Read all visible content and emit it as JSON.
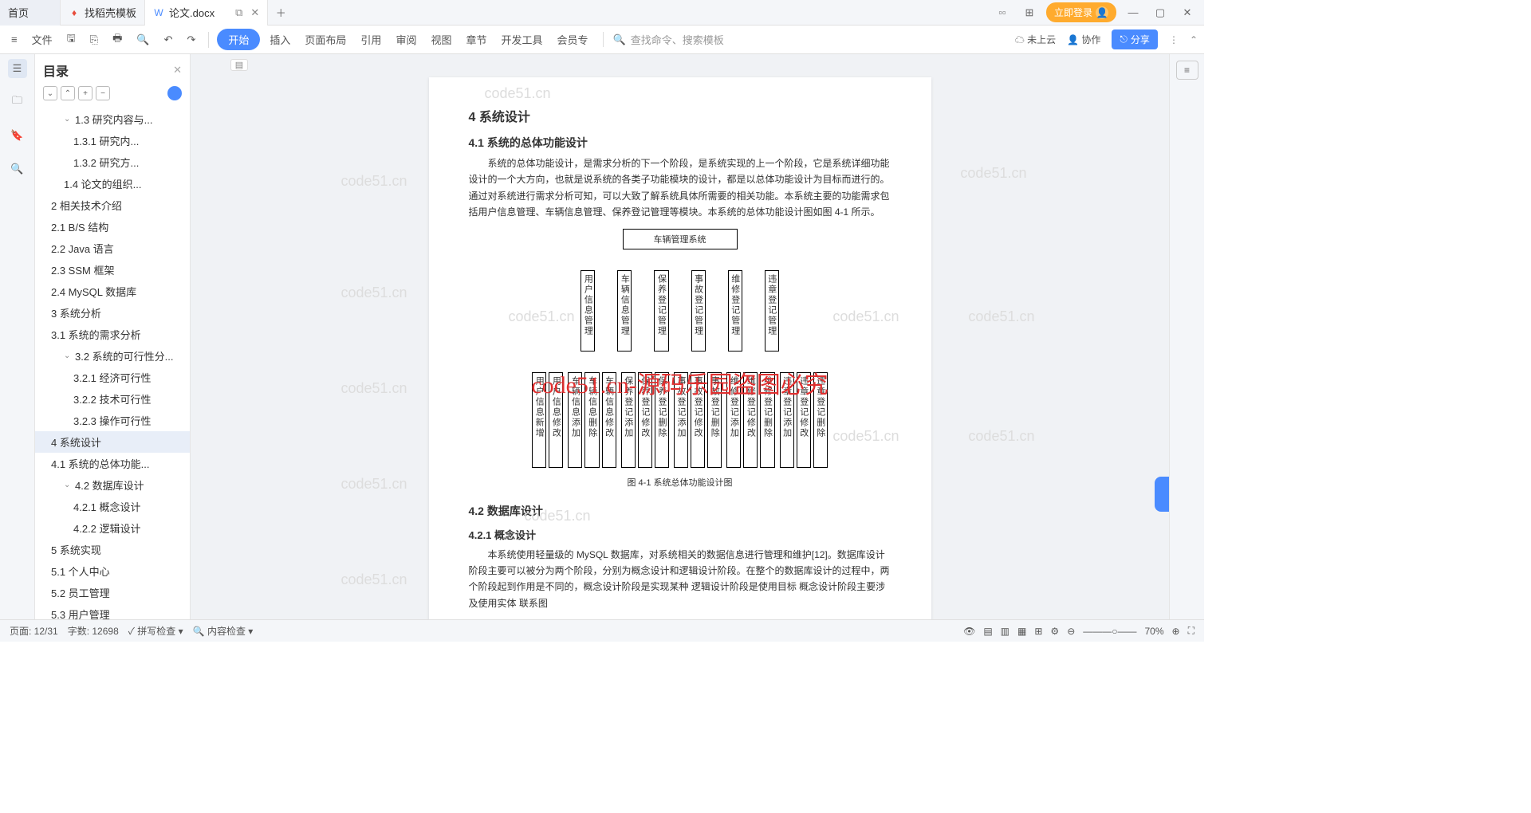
{
  "tabs": {
    "home": "首页",
    "t1": "找稻壳模板",
    "t2": "论文.docx"
  },
  "login": "立即登录",
  "ribbon": {
    "file": "文件",
    "start": "开始",
    "insert": "插入",
    "layout": "页面布局",
    "ref": "引用",
    "review": "审阅",
    "view": "视图",
    "chapter": "章节",
    "dev": "开发工具",
    "member": "会员专",
    "searchPlaceholder": "查找命令、搜索模板",
    "cloud": "未上云",
    "collab": "协作",
    "share": "分享"
  },
  "outline": {
    "title": "目录",
    "items": [
      {
        "t": "1.3 研究内容与...",
        "l": 2,
        "c": 1
      },
      {
        "t": "1.3.1 研究内...",
        "l": 3
      },
      {
        "t": "1.3.2 研究方...",
        "l": 3
      },
      {
        "t": "1.4 论文的组织...",
        "l": 2
      },
      {
        "t": "2 相关技术介绍",
        "l": 1
      },
      {
        "t": "2.1 B/S 结构",
        "l": 1
      },
      {
        "t": "2.2 Java 语言",
        "l": 1
      },
      {
        "t": "2.3 SSM 框架",
        "l": 1
      },
      {
        "t": "2.4 MySQL 数据库",
        "l": 1
      },
      {
        "t": "3 系统分析",
        "l": 1
      },
      {
        "t": "3.1 系统的需求分析",
        "l": 1
      },
      {
        "t": "3.2 系统的可行性分...",
        "l": 2,
        "c": 1
      },
      {
        "t": "3.2.1 经济可行性",
        "l": 3
      },
      {
        "t": "3.2.2 技术可行性",
        "l": 3
      },
      {
        "t": "3.2.3 操作可行性",
        "l": 3
      },
      {
        "t": "4 系统设计",
        "l": 1,
        "sel": 1
      },
      {
        "t": "4.1 系统的总体功能...",
        "l": 1
      },
      {
        "t": "4.2 数据库设计",
        "l": 2,
        "c": 1
      },
      {
        "t": "4.2.1 概念设计",
        "l": 3
      },
      {
        "t": "4.2.2 逻辑设计",
        "l": 3
      },
      {
        "t": "5 系统实现",
        "l": 1
      },
      {
        "t": "5.1 个人中心",
        "l": 1
      },
      {
        "t": "5.2 员工管理",
        "l": 1
      },
      {
        "t": "5.3 用户管理",
        "l": 1
      }
    ]
  },
  "doc": {
    "h4": "4 系统设计",
    "h41": "4.1 系统的总体功能设计",
    "p41": "系统的总体功能设计，是需求分析的下一个阶段，是系统实现的上一个阶段，它是系统详细功能设计的一个大方向，也就是说系统的各类子功能模块的设计，都是以总体功能设计为目标而进行的。通过对系统进行需求分析可知，可以大致了解系统具体所需要的相关功能。本系统主要的功能需求包括用户信息管理、车辆信息管理、保养登记管理等模块。本系统的总体功能设计图如图 4-1 所示。",
    "caption": "图 4-1 系统总体功能设计图",
    "h42": "4.2 数据库设计",
    "h421": "4.2.1 概念设计",
    "p421": "本系统使用轻量级的 MySQL 数据库，对系统相关的数据信息进行管理和维护[12]。数据库设计阶段主要可以被分为两个阶段，分别为概念设计和逻辑设计阶段。在整个的数据库设计的过程中，两个阶段起到作用是不同的，概念设计阶段是实现某种  逻辑设计阶段是使用目标  概念设计阶段主要涉及使用实体 联系图"
  },
  "chart_data": {
    "type": "diagram",
    "root": "车辆管理系统",
    "level1": [
      "用户信息管理",
      "车辆信息管理",
      "保养登记管理",
      "事故登记管理",
      "维修登记管理",
      "违章登记管理"
    ],
    "level2": [
      [
        "用户信息新增",
        "用户信息修改"
      ],
      [
        "车辆信息添加",
        "车辆信息删除",
        "车辆信息修改"
      ],
      [
        "保养登记添加",
        "保养登记修改",
        "保养登记删除"
      ],
      [
        "事故登记添加",
        "事故登记修改",
        "事故登记删除"
      ],
      [
        "维修登记添加",
        "维修登记修改",
        "维修登记删除"
      ],
      [
        "违章登记添加",
        "违章登记修改",
        "违章登记删除"
      ]
    ]
  },
  "watermark": "code51.cn",
  "redmark": "code51.cn-源码乐园盗图必究",
  "status": {
    "page": "页面: 12/31",
    "words": "字数: 12698",
    "spell": "拼写检查",
    "content": "内容检查",
    "zoom": "70%"
  }
}
